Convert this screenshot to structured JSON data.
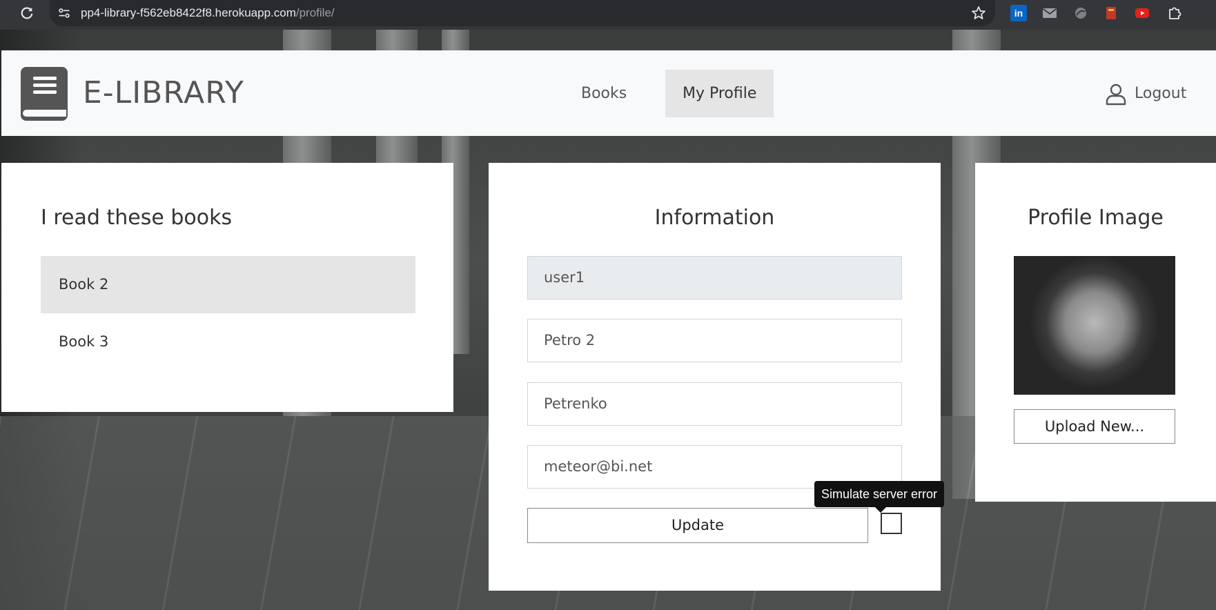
{
  "browser": {
    "url_host": "pp4-library-f562eb8422f8.herokuapp.com",
    "url_path": "/profile/",
    "extensions": [
      "linkedin-icon",
      "mail-icon",
      "circle-extension-icon",
      "book-extension-icon",
      "youtube-icon",
      "puzzle-icon"
    ]
  },
  "navbar": {
    "brand": "E-LIBRARY",
    "links": {
      "books": "Books",
      "profile": "My Profile"
    },
    "active_link": "My Profile",
    "logout": "Logout"
  },
  "books_card": {
    "title": "I read these books",
    "books": [
      "Book 2",
      "Book 3"
    ],
    "active_book": "Book 2"
  },
  "info_card": {
    "title": "Information",
    "username": "user1",
    "first_name": "Petro 2",
    "last_name": "Petrenko",
    "email": "meteor@bi.net",
    "update_label": "Update",
    "tooltip": "Simulate server error",
    "simulate_error_checked": false
  },
  "image_card": {
    "title": "Profile Image",
    "upload_label": "Upload New..."
  },
  "colors": {
    "navbar_bg": "#f8f9fa",
    "active_bg": "#e5e5e5",
    "readonly_field_bg": "#e9ecef",
    "tooltip_bg": "#111111"
  }
}
